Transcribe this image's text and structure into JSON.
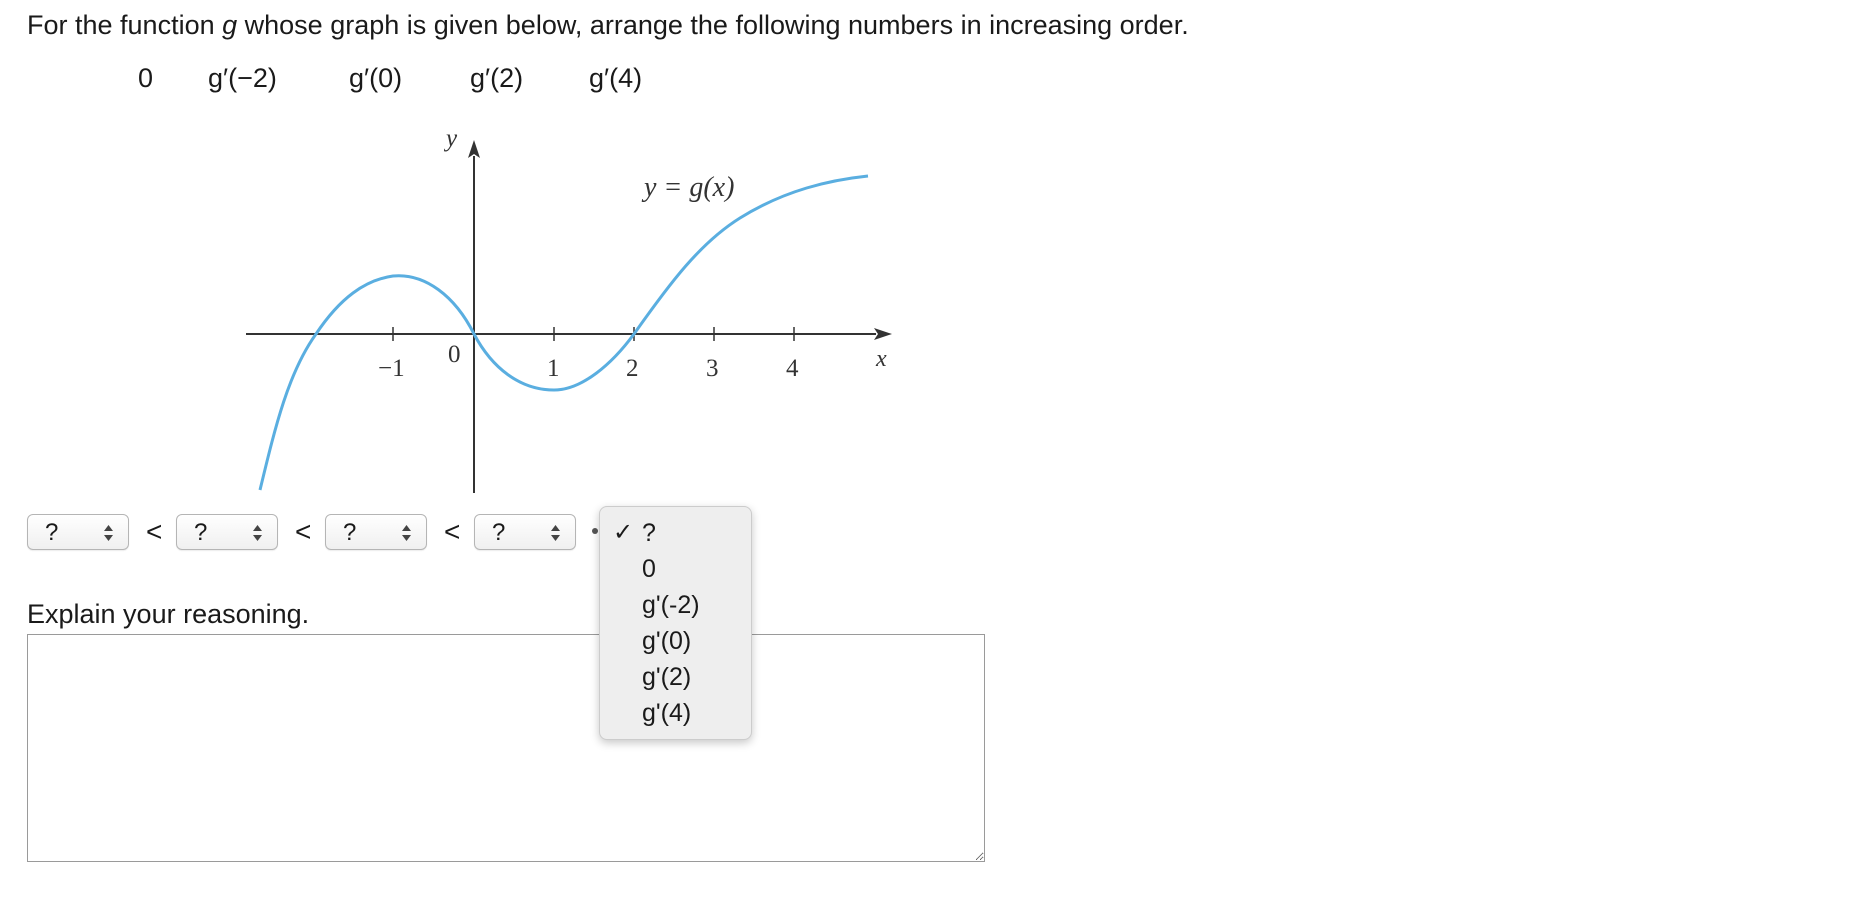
{
  "question": {
    "prefix": "For the function ",
    "function_name": "g",
    "suffix": " whose graph is given below, arrange the following numbers in increasing order."
  },
  "numbers": [
    "0",
    "g′(−2)",
    "g′(0)",
    "g′(2)",
    "g′(4)"
  ],
  "graph": {
    "curve_label": "y = g(x)",
    "y_axis_label": "y",
    "x_axis_label": "x",
    "x_ticks": [
      "−1",
      "0",
      "1",
      "2",
      "3",
      "4"
    ],
    "curve_color": "#5aaee0"
  },
  "selects": [
    {
      "value": "?"
    },
    {
      "value": "?"
    },
    {
      "value": "?"
    },
    {
      "value": "?"
    }
  ],
  "less_than": "<",
  "dropdown": {
    "checkmark": "✓",
    "options": [
      "?",
      "0",
      "g'(-2)",
      "g'(0)",
      "g'(2)",
      "g'(4)"
    ],
    "selected_index": 0
  },
  "explain": {
    "label": "Explain your reasoning.",
    "value": ""
  }
}
